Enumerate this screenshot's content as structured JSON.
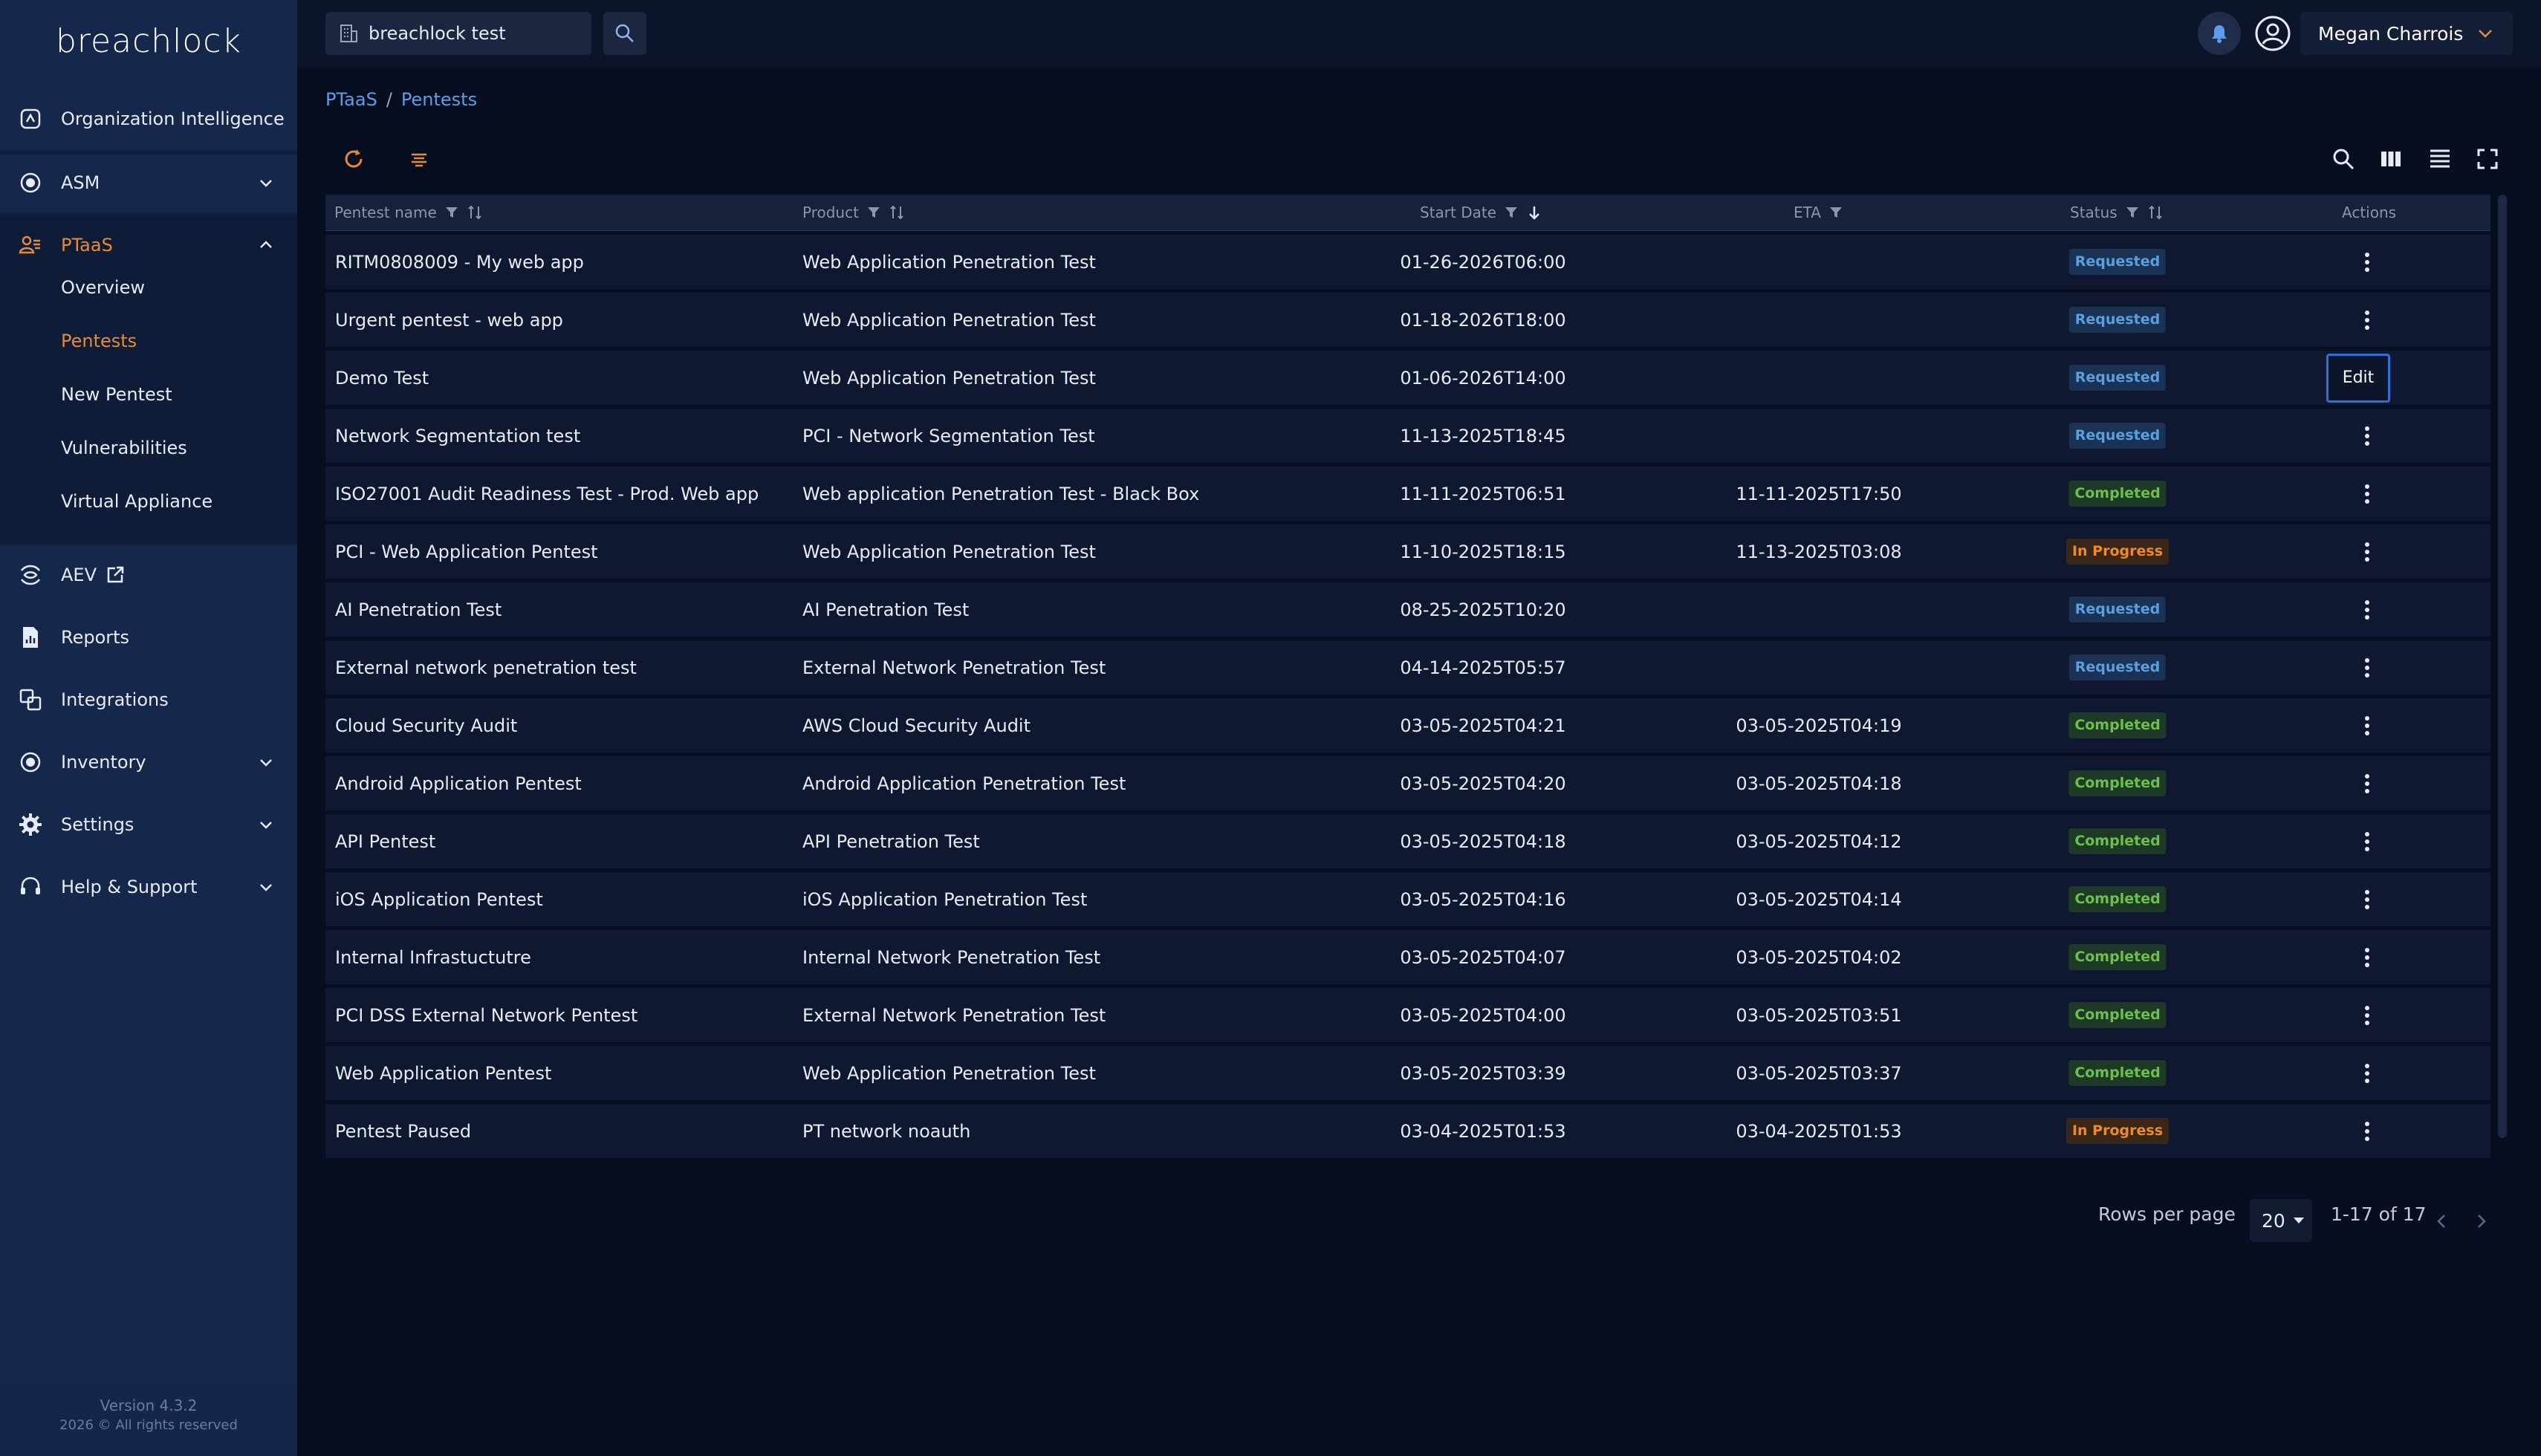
{
  "brand": {
    "logo": "breachlock"
  },
  "sidebar": {
    "items": [
      {
        "label": "Organization Intelligence",
        "icon": "org-intel-icon"
      },
      {
        "label": "ASM",
        "icon": "asm-icon"
      },
      {
        "label": "PTaaS",
        "icon": "ptaas-icon"
      },
      {
        "label": "AEV",
        "icon": "aev-icon"
      },
      {
        "label": "Reports",
        "icon": "reports-icon"
      },
      {
        "label": "Integrations",
        "icon": "integrations-icon"
      },
      {
        "label": "Inventory",
        "icon": "inventory-icon"
      },
      {
        "label": "Settings",
        "icon": "gear-icon"
      },
      {
        "label": "Help & Support",
        "icon": "help-icon"
      }
    ],
    "ptaas_sub": [
      "Overview",
      "Pentests",
      "New Pentest",
      "Vulnerabilities",
      "Virtual Appliance"
    ],
    "version": "Version 4.3.2",
    "copyright": "2026 © All rights reserved"
  },
  "topbar": {
    "org": "breachlock test",
    "user": "Megan Charrois"
  },
  "breadcrumb": {
    "root": "PTaaS",
    "sep": "/",
    "current": "Pentests"
  },
  "table": {
    "columns": {
      "name": "Pentest name",
      "product": "Product",
      "start": "Start Date",
      "eta": "ETA",
      "status": "Status",
      "actions": "Actions"
    },
    "edit_label": "Edit",
    "rows": [
      {
        "name": "RITM0808009 - My web app",
        "product": "Web Application Penetration Test",
        "start": "01-26-2026T06:00",
        "eta": "",
        "status": "Requested"
      },
      {
        "name": "Urgent pentest - web app",
        "product": "Web Application Penetration Test",
        "start": "01-18-2026T18:00",
        "eta": "",
        "status": "Requested"
      },
      {
        "name": "Demo Test",
        "product": "Web Application Penetration Test",
        "start": "01-06-2026T14:00",
        "eta": "",
        "status": "Requested"
      },
      {
        "name": "Network Segmentation test",
        "product": "PCI - Network Segmentation Test",
        "start": "11-13-2025T18:45",
        "eta": "",
        "status": "Requested"
      },
      {
        "name": "ISO27001 Audit Readiness Test - Prod. Web app",
        "product": "Web application Penetration Test - Black Box",
        "start": "11-11-2025T06:51",
        "eta": "11-11-2025T17:50",
        "status": "Completed"
      },
      {
        "name": "PCI - Web Application Pentest",
        "product": "Web Application Penetration Test",
        "start": "11-10-2025T18:15",
        "eta": "11-13-2025T03:08",
        "status": "In Progress"
      },
      {
        "name": "AI Penetration Test",
        "product": "AI Penetration Test",
        "start": "08-25-2025T10:20",
        "eta": "",
        "status": "Requested"
      },
      {
        "name": "External network penetration test",
        "product": "External Network Penetration Test",
        "start": "04-14-2025T05:57",
        "eta": "",
        "status": "Requested"
      },
      {
        "name": "Cloud Security Audit",
        "product": "AWS Cloud Security Audit",
        "start": "03-05-2025T04:21",
        "eta": "03-05-2025T04:19",
        "status": "Completed"
      },
      {
        "name": "Android Application Pentest",
        "product": "Android Application Penetration Test",
        "start": "03-05-2025T04:20",
        "eta": "03-05-2025T04:18",
        "status": "Completed"
      },
      {
        "name": "API Pentest",
        "product": "API Penetration Test",
        "start": "03-05-2025T04:18",
        "eta": "03-05-2025T04:12",
        "status": "Completed"
      },
      {
        "name": "iOS Application Pentest",
        "product": "iOS Application Penetration Test",
        "start": "03-05-2025T04:16",
        "eta": "03-05-2025T04:14",
        "status": "Completed"
      },
      {
        "name": "Internal Infrastuctutre",
        "product": "Internal Network Penetration Test",
        "start": "03-05-2025T04:07",
        "eta": "03-05-2025T04:02",
        "status": "Completed"
      },
      {
        "name": "PCI DSS External Network Pentest",
        "product": "External Network Penetration Test",
        "start": "03-05-2025T04:00",
        "eta": "03-05-2025T03:51",
        "status": "Completed"
      },
      {
        "name": "Web Application Pentest",
        "product": "Web Application Penetration Test",
        "start": "03-05-2025T03:39",
        "eta": "03-05-2025T03:37",
        "status": "Completed"
      },
      {
        "name": "Pentest Paused",
        "product": "PT network noauth",
        "start": "03-04-2025T01:53",
        "eta": "03-04-2025T01:53",
        "status": "In Progress"
      }
    ]
  },
  "status_colors": {
    "Requested": {
      "fg": "#5aa0e0",
      "bg": "#1a3253"
    },
    "Completed": {
      "fg": "#6cc04a",
      "bg": "#1d3a26"
    },
    "In Progress": {
      "fg": "#f08a24",
      "bg": "#3a2616"
    }
  },
  "pagination": {
    "rows_per_page_label": "Rows per page",
    "rows_per_page": "20",
    "range": "1-17 of 17"
  },
  "colors": {
    "accent": "#e58a3a",
    "link": "#5c9ce8",
    "sidebar": "#15284c",
    "background": "#070e1f"
  }
}
